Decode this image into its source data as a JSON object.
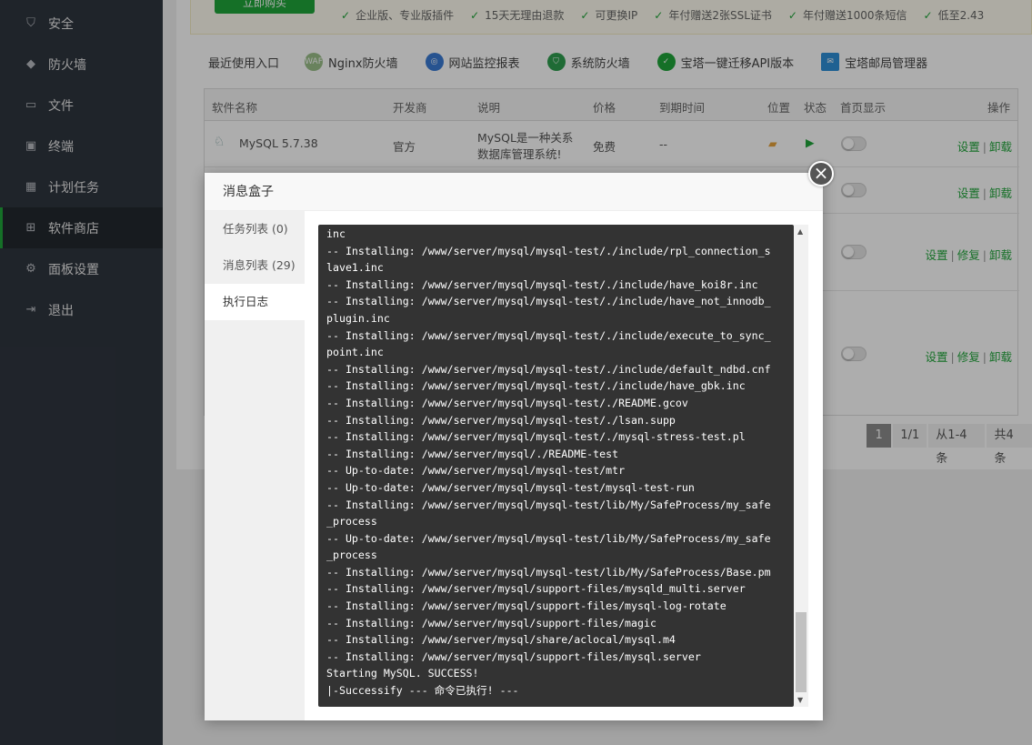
{
  "sidebar": {
    "items": [
      {
        "label": "安全",
        "icon": "shield-check-icon"
      },
      {
        "label": "防火墙",
        "icon": "shield-icon"
      },
      {
        "label": "文件",
        "icon": "folder-icon"
      },
      {
        "label": "终端",
        "icon": "terminal-icon"
      },
      {
        "label": "计划任务",
        "icon": "calendar-icon"
      },
      {
        "label": "软件商店",
        "icon": "grid-icon"
      },
      {
        "label": "面板设置",
        "icon": "gear-icon"
      },
      {
        "label": "退出",
        "icon": "logout-icon"
      }
    ],
    "active_index": 5
  },
  "promo": {
    "button": "立即购买",
    "features": [
      "企业版、专业版插件",
      "15天无理由退款",
      "可更换IP",
      "年付赠送2张SSL证书",
      "年付赠送1000条短信",
      "低至2.43"
    ]
  },
  "recent": {
    "label": "最近使用入口",
    "entries": [
      {
        "label": "Nginx防火墙",
        "icon": "waf-icon",
        "color": "#9bc08a"
      },
      {
        "label": "网站监控报表",
        "icon": "globe-icon",
        "color": "#3a7bd5"
      },
      {
        "label": "系统防火墙",
        "icon": "shield-icon",
        "color": "#2e9e4f"
      },
      {
        "label": "宝塔一键迁移API版本",
        "icon": "check-circle-icon",
        "color": "#20a53a"
      },
      {
        "label": "宝塔邮局管理器",
        "icon": "mail-icon",
        "color": "#2f8fd8"
      }
    ]
  },
  "table": {
    "headers": {
      "name": "软件名称",
      "vendor": "开发商",
      "desc": "说明",
      "price": "价格",
      "expire": "到期时间",
      "location": "位置",
      "status": "状态",
      "home": "首页显示",
      "ops": "操作"
    },
    "row1": {
      "name": "MySQL 5.7.38",
      "vendor": "官方",
      "desc1": "MySQL是一种关系",
      "desc2": "数据库管理系统!",
      "price": "免费",
      "expire": "--",
      "op_settings": "设置",
      "op_uninstall": "卸载"
    },
    "row2": {
      "op_settings": "设置",
      "op_uninstall": "卸载"
    },
    "row3": {
      "op_settings": "设置",
      "op_repair": "修复",
      "op_uninstall": "卸载"
    },
    "row4": {
      "op_settings": "设置",
      "op_repair": "修复",
      "op_uninstall": "卸载"
    },
    "sep": "|"
  },
  "pager": {
    "current": "1",
    "pages": "1/1",
    "range": "从1-4条",
    "total": "共4条"
  },
  "modal": {
    "title": "消息盒子",
    "close": "×",
    "tabs": [
      "任务列表 (0)",
      "消息列表 (29)",
      "执行日志"
    ],
    "active_tab": 2,
    "log": [
      "inc",
      "-- Installing: /www/server/mysql/mysql-test/./include/rpl_connection_s",
      "lave1.inc",
      "-- Installing: /www/server/mysql/mysql-test/./include/have_koi8r.inc",
      "-- Installing: /www/server/mysql/mysql-test/./include/have_not_innodb_",
      "plugin.inc",
      "-- Installing: /www/server/mysql/mysql-test/./include/execute_to_sync_",
      "point.inc",
      "-- Installing: /www/server/mysql/mysql-test/./include/default_ndbd.cnf",
      "-- Installing: /www/server/mysql/mysql-test/./include/have_gbk.inc",
      "-- Installing: /www/server/mysql/mysql-test/./README.gcov",
      "-- Installing: /www/server/mysql/mysql-test/./lsan.supp",
      "-- Installing: /www/server/mysql/mysql-test/./mysql-stress-test.pl",
      "-- Installing: /www/server/mysql/./README-test",
      "-- Up-to-date: /www/server/mysql/mysql-test/mtr",
      "-- Up-to-date: /www/server/mysql/mysql-test/mysql-test-run",
      "-- Installing: /www/server/mysql/mysql-test/lib/My/SafeProcess/my_safe",
      "_process",
      "-- Up-to-date: /www/server/mysql/mysql-test/lib/My/SafeProcess/my_safe",
      "_process",
      "-- Installing: /www/server/mysql/mysql-test/lib/My/SafeProcess/Base.pm",
      "-- Installing: /www/server/mysql/support-files/mysqld_multi.server",
      "-- Installing: /www/server/mysql/support-files/mysql-log-rotate",
      "-- Installing: /www/server/mysql/support-files/magic",
      "-- Installing: /www/server/mysql/share/aclocal/mysql.m4",
      "-- Installing: /www/server/mysql/support-files/mysql.server",
      "Starting MySQL. SUCCESS!",
      "|-Successify --- 命令已执行! ---"
    ]
  }
}
